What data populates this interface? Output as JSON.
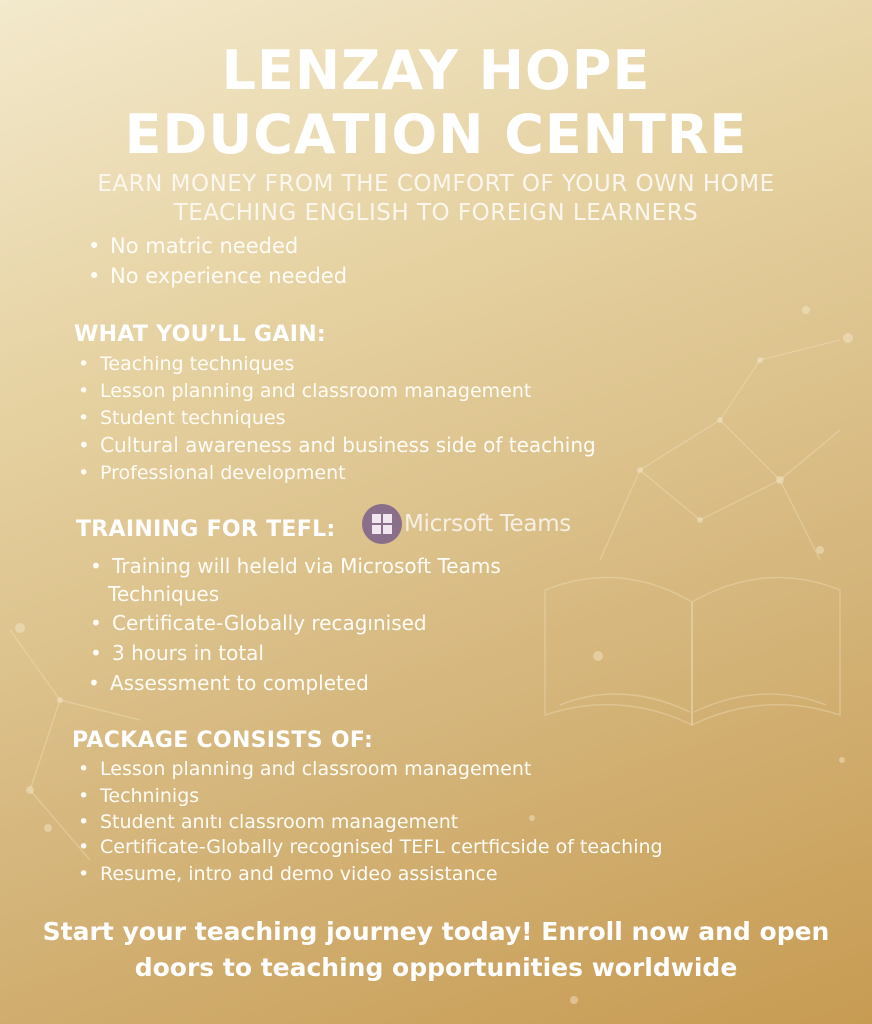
{
  "header": {
    "title_line1": "LENZAY HOPE",
    "title_line2": "EDUCATION CENTRE",
    "tagline_line1": "EARN MONEY FROM THE COMFORT OF YOUR OWN HOME",
    "tagline_line2": "TEACHING ENGLISH TO FOREIGN LEARNERS"
  },
  "requirements": [
    "No matric needed",
    "No experience needed"
  ],
  "gain": {
    "heading": "WHAT YOU’LL GAIN:",
    "items": [
      "Teaching techniques",
      "Lesson planning and classroom management",
      "Student techniques",
      "Cultural awareness and business side of teaching",
      "Professional development"
    ]
  },
  "training": {
    "heading": "TRAINING FOR TEFL:",
    "platform_name": "Micrsoft Teams",
    "platform_icon": "microsoft-teams-icon",
    "items": [
      "Training will heleld via Microsoft Teams",
      "Techniques",
      "Certificate-Globally recagınised",
      "3 hours in total",
      "Assessment to completed"
    ]
  },
  "package": {
    "heading": "PACKAGE CONSISTS OF:",
    "items": [
      "Lesson planning and classroom management",
      "Techninigs",
      "Student anıtı classroom management",
      "Certificate-Globally recognised TEFL certficside of teaching",
      "Resume, intro and demo video assistance"
    ]
  },
  "cta": {
    "line1": "Start your teaching journey today! Enroll now and open",
    "line2": "doors to teaching opportunities worldwide"
  },
  "colors": {
    "background_light": "#f3e9cc",
    "background_dark": "#c79b52",
    "text": "#ffffff",
    "teams_logo": "#8a6f8a"
  }
}
